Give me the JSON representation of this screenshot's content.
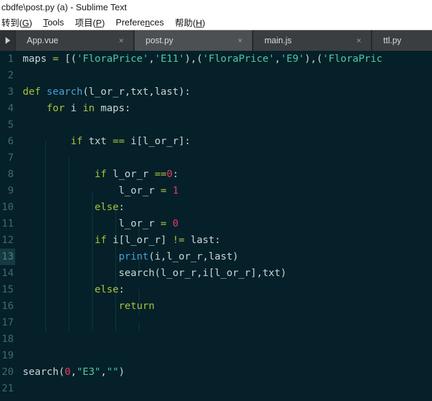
{
  "window": {
    "title": "cbdfe\\post.py (a) - Sublime Text"
  },
  "menubar": {
    "items": [
      {
        "label": "转到(G)",
        "mnemonic": "G"
      },
      {
        "label": "Tools",
        "mnemonic": "T"
      },
      {
        "label": "项目(P)",
        "mnemonic": "P"
      },
      {
        "label": "Preferences",
        "mnemonic": "n"
      },
      {
        "label": "帮助(H)",
        "mnemonic": "H"
      }
    ]
  },
  "tabbar": {
    "scroll_icon": "triangle-right-icon",
    "close_glyph": "×",
    "tabs": [
      {
        "label": "App.vue",
        "active": false,
        "closable": true
      },
      {
        "label": "post.py",
        "active": true,
        "closable": true
      },
      {
        "label": "main.js",
        "active": false,
        "closable": true
      },
      {
        "label": "ttl.py",
        "active": false,
        "closable": false
      }
    ]
  },
  "editor": {
    "language": "Python",
    "cursor_line": 13,
    "colors": {
      "background": "#052028",
      "gutter_text": "#3f6a72",
      "keyword": "#a6c33c",
      "function": "#4d9fd6",
      "string": "#4ec9a7",
      "number": "#e5376f",
      "text": "#c8d6d8",
      "indent_guide": "#113540",
      "cursor_line_gutter": "#163a42"
    },
    "lines": [
      {
        "num": "1",
        "tokens": [
          {
            "t": "maps ",
            "c": "t-plain"
          },
          {
            "t": "=",
            "c": "t-op"
          },
          {
            "t": " [(",
            "c": "t-punc"
          },
          {
            "t": "'FloraPrice'",
            "c": "t-str"
          },
          {
            "t": ",",
            "c": "t-punc"
          },
          {
            "t": "'E11'",
            "c": "t-str"
          },
          {
            "t": "),(",
            "c": "t-punc"
          },
          {
            "t": "'FloraPrice'",
            "c": "t-str"
          },
          {
            "t": ",",
            "c": "t-punc"
          },
          {
            "t": "'E9'",
            "c": "t-str"
          },
          {
            "t": "),(",
            "c": "t-punc"
          },
          {
            "t": "'FloraPric",
            "c": "t-str"
          }
        ]
      },
      {
        "num": "2",
        "tokens": []
      },
      {
        "num": "3",
        "tokens": [
          {
            "t": "def ",
            "c": "t-kw"
          },
          {
            "t": "search",
            "c": "t-fn"
          },
          {
            "t": "(l_or_r,txt,last):",
            "c": "t-plain"
          }
        ]
      },
      {
        "num": "4",
        "tokens": [
          {
            "t": "    ",
            "c": "t-plain"
          },
          {
            "t": "for",
            "c": "t-kw"
          },
          {
            "t": " i ",
            "c": "t-plain"
          },
          {
            "t": "in",
            "c": "t-kw"
          },
          {
            "t": " maps:",
            "c": "t-plain"
          }
        ]
      },
      {
        "num": "5",
        "tokens": []
      },
      {
        "num": "6",
        "tokens": [
          {
            "t": "        ",
            "c": "t-plain"
          },
          {
            "t": "if",
            "c": "t-kw"
          },
          {
            "t": " txt ",
            "c": "t-plain"
          },
          {
            "t": "==",
            "c": "t-op"
          },
          {
            "t": " i[l_or_r]:",
            "c": "t-plain"
          }
        ]
      },
      {
        "num": "7",
        "tokens": []
      },
      {
        "num": "8",
        "tokens": [
          {
            "t": "            ",
            "c": "t-plain"
          },
          {
            "t": "if",
            "c": "t-kw"
          },
          {
            "t": " l_or_r ",
            "c": "t-plain"
          },
          {
            "t": "==",
            "c": "t-op"
          },
          {
            "t": "0",
            "c": "t-num"
          },
          {
            "t": ":",
            "c": "t-plain"
          }
        ]
      },
      {
        "num": "9",
        "tokens": [
          {
            "t": "                l_or_r ",
            "c": "t-plain"
          },
          {
            "t": "=",
            "c": "t-op"
          },
          {
            "t": " ",
            "c": "t-plain"
          },
          {
            "t": "1",
            "c": "t-num"
          }
        ]
      },
      {
        "num": "10",
        "tokens": [
          {
            "t": "            ",
            "c": "t-plain"
          },
          {
            "t": "else",
            "c": "t-kw"
          },
          {
            "t": ":",
            "c": "t-plain"
          }
        ]
      },
      {
        "num": "11",
        "tokens": [
          {
            "t": "                l_or_r ",
            "c": "t-plain"
          },
          {
            "t": "=",
            "c": "t-op"
          },
          {
            "t": " ",
            "c": "t-plain"
          },
          {
            "t": "0",
            "c": "t-num"
          }
        ]
      },
      {
        "num": "12",
        "tokens": [
          {
            "t": "            ",
            "c": "t-plain"
          },
          {
            "t": "if",
            "c": "t-kw"
          },
          {
            "t": " i[l_or_r] ",
            "c": "t-plain"
          },
          {
            "t": "!=",
            "c": "t-op"
          },
          {
            "t": " last:",
            "c": "t-plain"
          }
        ]
      },
      {
        "num": "13",
        "tokens": [
          {
            "t": "                ",
            "c": "t-plain"
          },
          {
            "t": "print",
            "c": "t-fn"
          },
          {
            "t": "(i,l_or_r,last)",
            "c": "t-plain"
          }
        ]
      },
      {
        "num": "14",
        "tokens": [
          {
            "t": "                search(l_or_r,i[l_or_r],txt)",
            "c": "t-plain"
          }
        ]
      },
      {
        "num": "15",
        "tokens": [
          {
            "t": "            ",
            "c": "t-plain"
          },
          {
            "t": "else",
            "c": "t-kw"
          },
          {
            "t": ":",
            "c": "t-plain"
          }
        ]
      },
      {
        "num": "16",
        "tokens": [
          {
            "t": "                ",
            "c": "t-plain"
          },
          {
            "t": "return",
            "c": "t-kw"
          }
        ]
      },
      {
        "num": "17",
        "tokens": []
      },
      {
        "num": "18",
        "tokens": []
      },
      {
        "num": "19",
        "tokens": []
      },
      {
        "num": "20",
        "tokens": [
          {
            "t": "search(",
            "c": "t-plain"
          },
          {
            "t": "0",
            "c": "t-num"
          },
          {
            "t": ",",
            "c": "t-plain"
          },
          {
            "t": "\"E3\"",
            "c": "t-str"
          },
          {
            "t": ",",
            "c": "t-plain"
          },
          {
            "t": "\"\"",
            "c": "t-str"
          },
          {
            "t": ")",
            "c": "t-plain"
          }
        ]
      },
      {
        "num": "21",
        "tokens": []
      }
    ]
  }
}
